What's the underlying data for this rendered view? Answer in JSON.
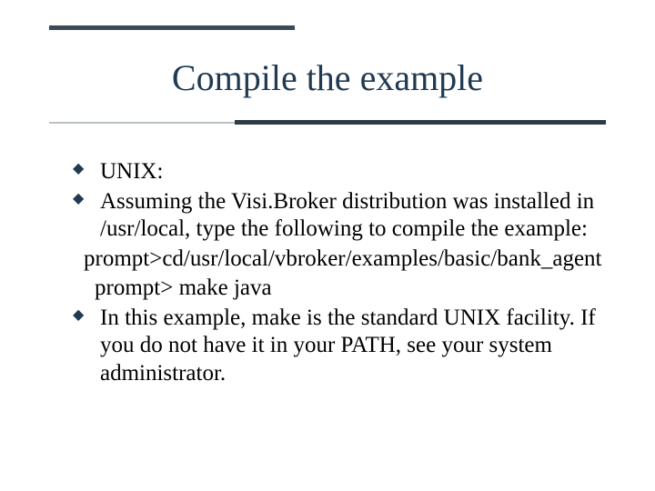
{
  "slide": {
    "title": "Compile the example",
    "items": {
      "b1": "UNIX:",
      "b2": "Assuming the Visi.Broker distribution was installed in /usr/local, type the following to compile the example:",
      "p1": "prompt>cd/usr/local/vbroker/examples/basic/bank_agent",
      "p2": "prompt> make java",
      "b3": " In this example, make is the standard UNIX facility. If you do not have it in your PATH, see your system administrator."
    }
  }
}
